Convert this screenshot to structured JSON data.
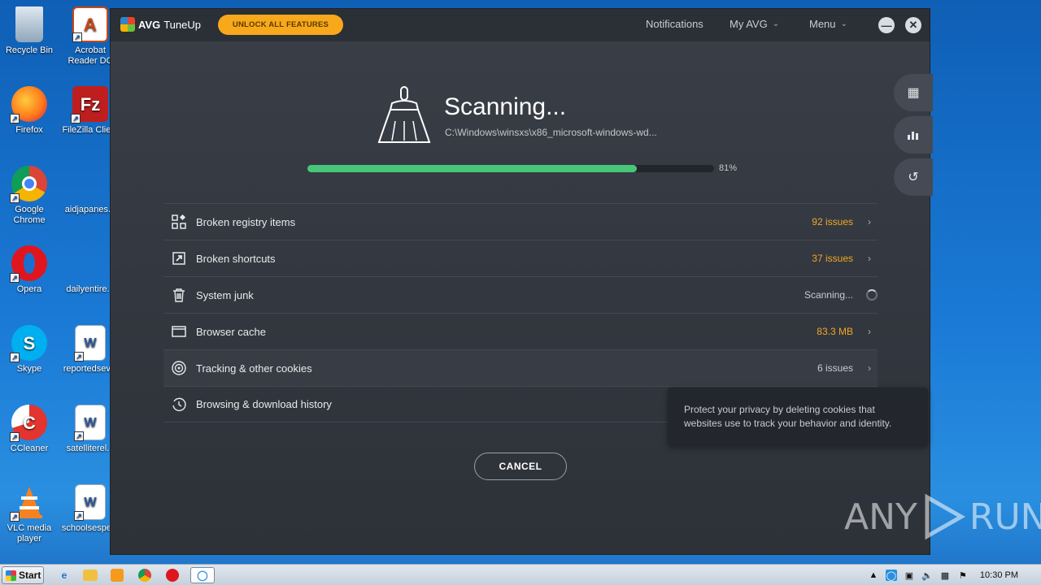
{
  "desktop": {
    "icons": [
      {
        "label": "Recycle Bin",
        "icon": "recycle-bin-icon"
      },
      {
        "label": "Acrobat Reader DC",
        "icon": "acrobat-icon"
      },
      {
        "label": "Firefox",
        "icon": "firefox-icon"
      },
      {
        "label": "FileZilla Client",
        "icon": "filezilla-icon"
      },
      {
        "label": "Google Chrome",
        "icon": "chrome-icon"
      },
      {
        "label": "aidjapanes...",
        "icon": "blank-file-icon"
      },
      {
        "label": "Opera",
        "icon": "opera-icon"
      },
      {
        "label": "dailyentire...",
        "icon": "blank-file-icon"
      },
      {
        "label": "Skype",
        "icon": "skype-icon"
      },
      {
        "label": "reportedsev...",
        "icon": "word-doc-icon"
      },
      {
        "label": "CCleaner",
        "icon": "ccleaner-icon"
      },
      {
        "label": "satelliterel...",
        "icon": "word-doc-icon"
      },
      {
        "label": "VLC media player",
        "icon": "vlc-icon"
      },
      {
        "label": "schoolsespe...",
        "icon": "word-doc-icon"
      }
    ]
  },
  "app": {
    "brand": "AVG",
    "product": "TuneUp",
    "unlock_label": "UNLOCK ALL FEATURES",
    "menu": {
      "notifications": "Notifications",
      "my_avg": "My AVG",
      "menu": "Menu"
    },
    "scan": {
      "title": "Scanning...",
      "path": "C:\\Windows\\winsxs\\x86_microsoft-windows-wd...",
      "progress_value": 81,
      "progress_label": "81%"
    },
    "items": [
      {
        "label": "Broken registry items",
        "status": "92 issues",
        "status_color": "orange",
        "icon": "registry-icon",
        "state": "done"
      },
      {
        "label": "Broken shortcuts",
        "status": "37 issues",
        "status_color": "orange",
        "icon": "shortcut-icon",
        "state": "done"
      },
      {
        "label": "System junk",
        "status": "Scanning...",
        "status_color": "grey",
        "icon": "trash-icon",
        "state": "scanning"
      },
      {
        "label": "Browser cache",
        "status": "83.3 MB",
        "status_color": "orange",
        "icon": "browser-window-icon",
        "state": "done"
      },
      {
        "label": "Tracking & other cookies",
        "status": "6 issues",
        "status_color": "grey",
        "icon": "target-icon",
        "state": "done"
      },
      {
        "label": "Browsing & download history",
        "status": "",
        "status_color": "grey",
        "icon": "history-icon",
        "state": "done"
      }
    ],
    "cancel_label": "CANCEL",
    "tooltip": "Protect your privacy by deleting cookies that websites use to track your behavior and identity.",
    "colors": {
      "accent_green": "#48c779",
      "accent_orange": "#f5a623",
      "unlock_bg": "#f7a81b"
    }
  },
  "taskbar": {
    "start_label": "Start",
    "clock": "10:30 PM"
  },
  "watermark": {
    "left": "ANY",
    "right": "RUN"
  }
}
